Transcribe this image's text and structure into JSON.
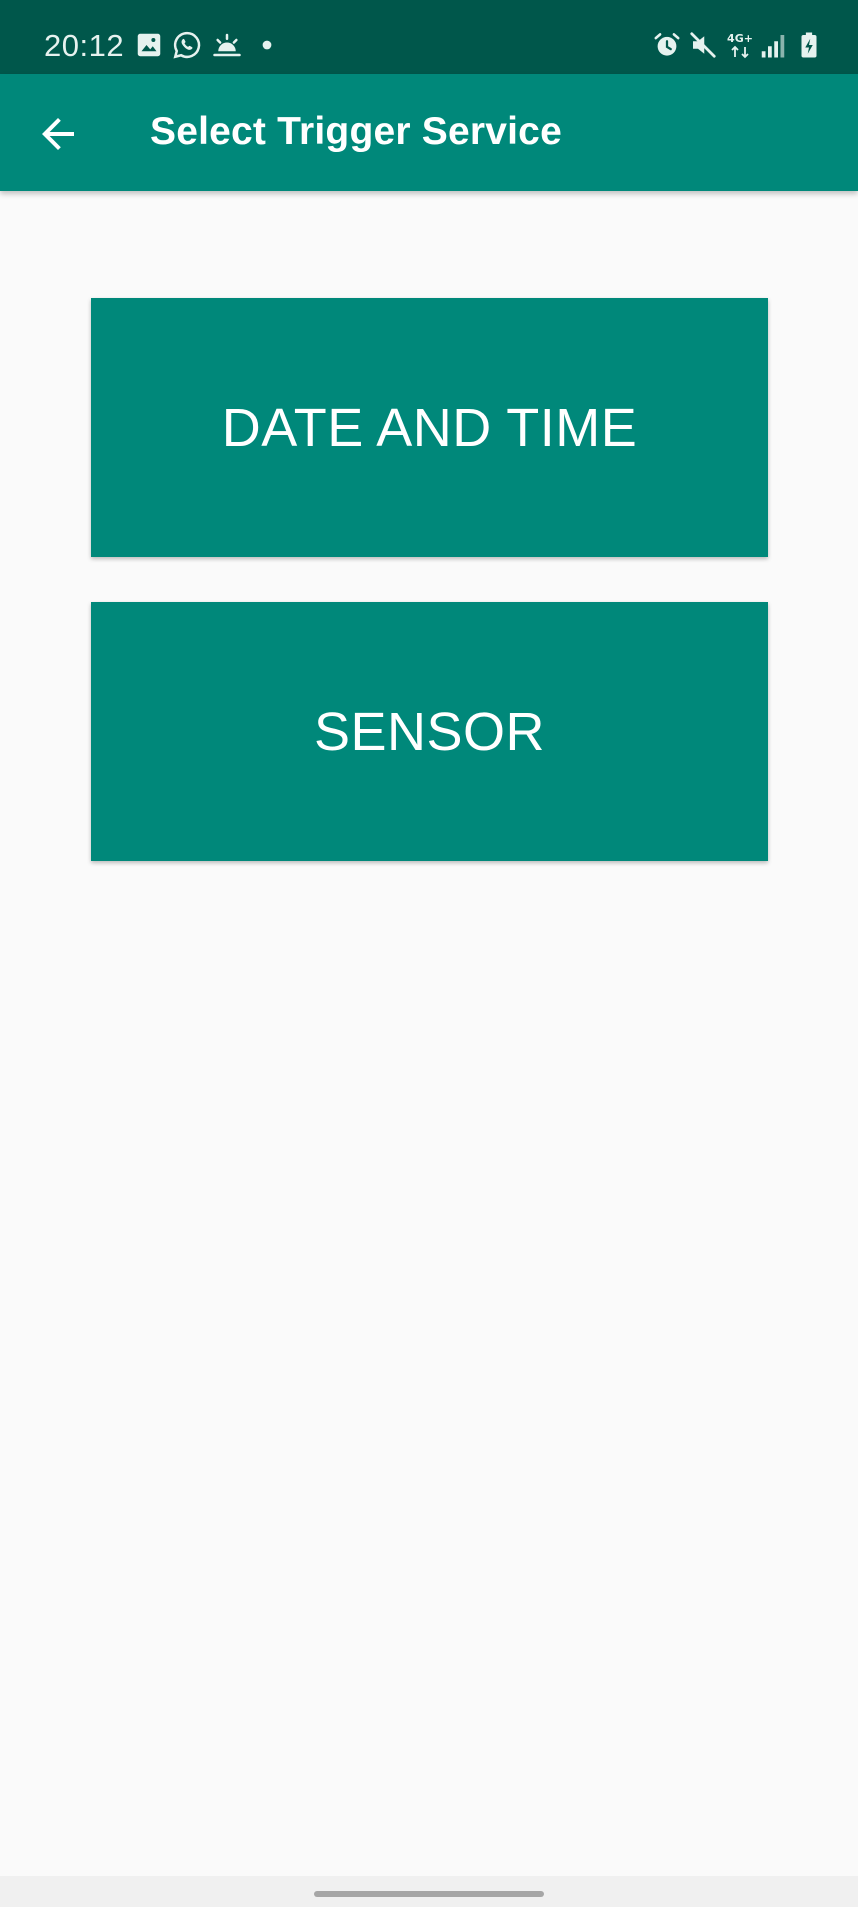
{
  "status_bar": {
    "time": "20:12",
    "left_icons": [
      "image-icon",
      "whatsapp-icon",
      "weather-sunrise-icon",
      "dot-icon"
    ],
    "right_icons": [
      "alarm-icon",
      "mute-icon",
      "network-4g-icon",
      "signal-icon",
      "battery-charging-icon"
    ],
    "network_label": "4G+"
  },
  "app_bar": {
    "back_icon": "arrow-back-icon",
    "title": "Select Trigger Service"
  },
  "options": [
    {
      "label": "DATE AND TIME"
    },
    {
      "label": "SENSOR"
    }
  ],
  "colors": {
    "status_bar": "#00574b",
    "primary": "#00887a",
    "background": "#fafafa",
    "text_on_primary": "#ffffff"
  }
}
